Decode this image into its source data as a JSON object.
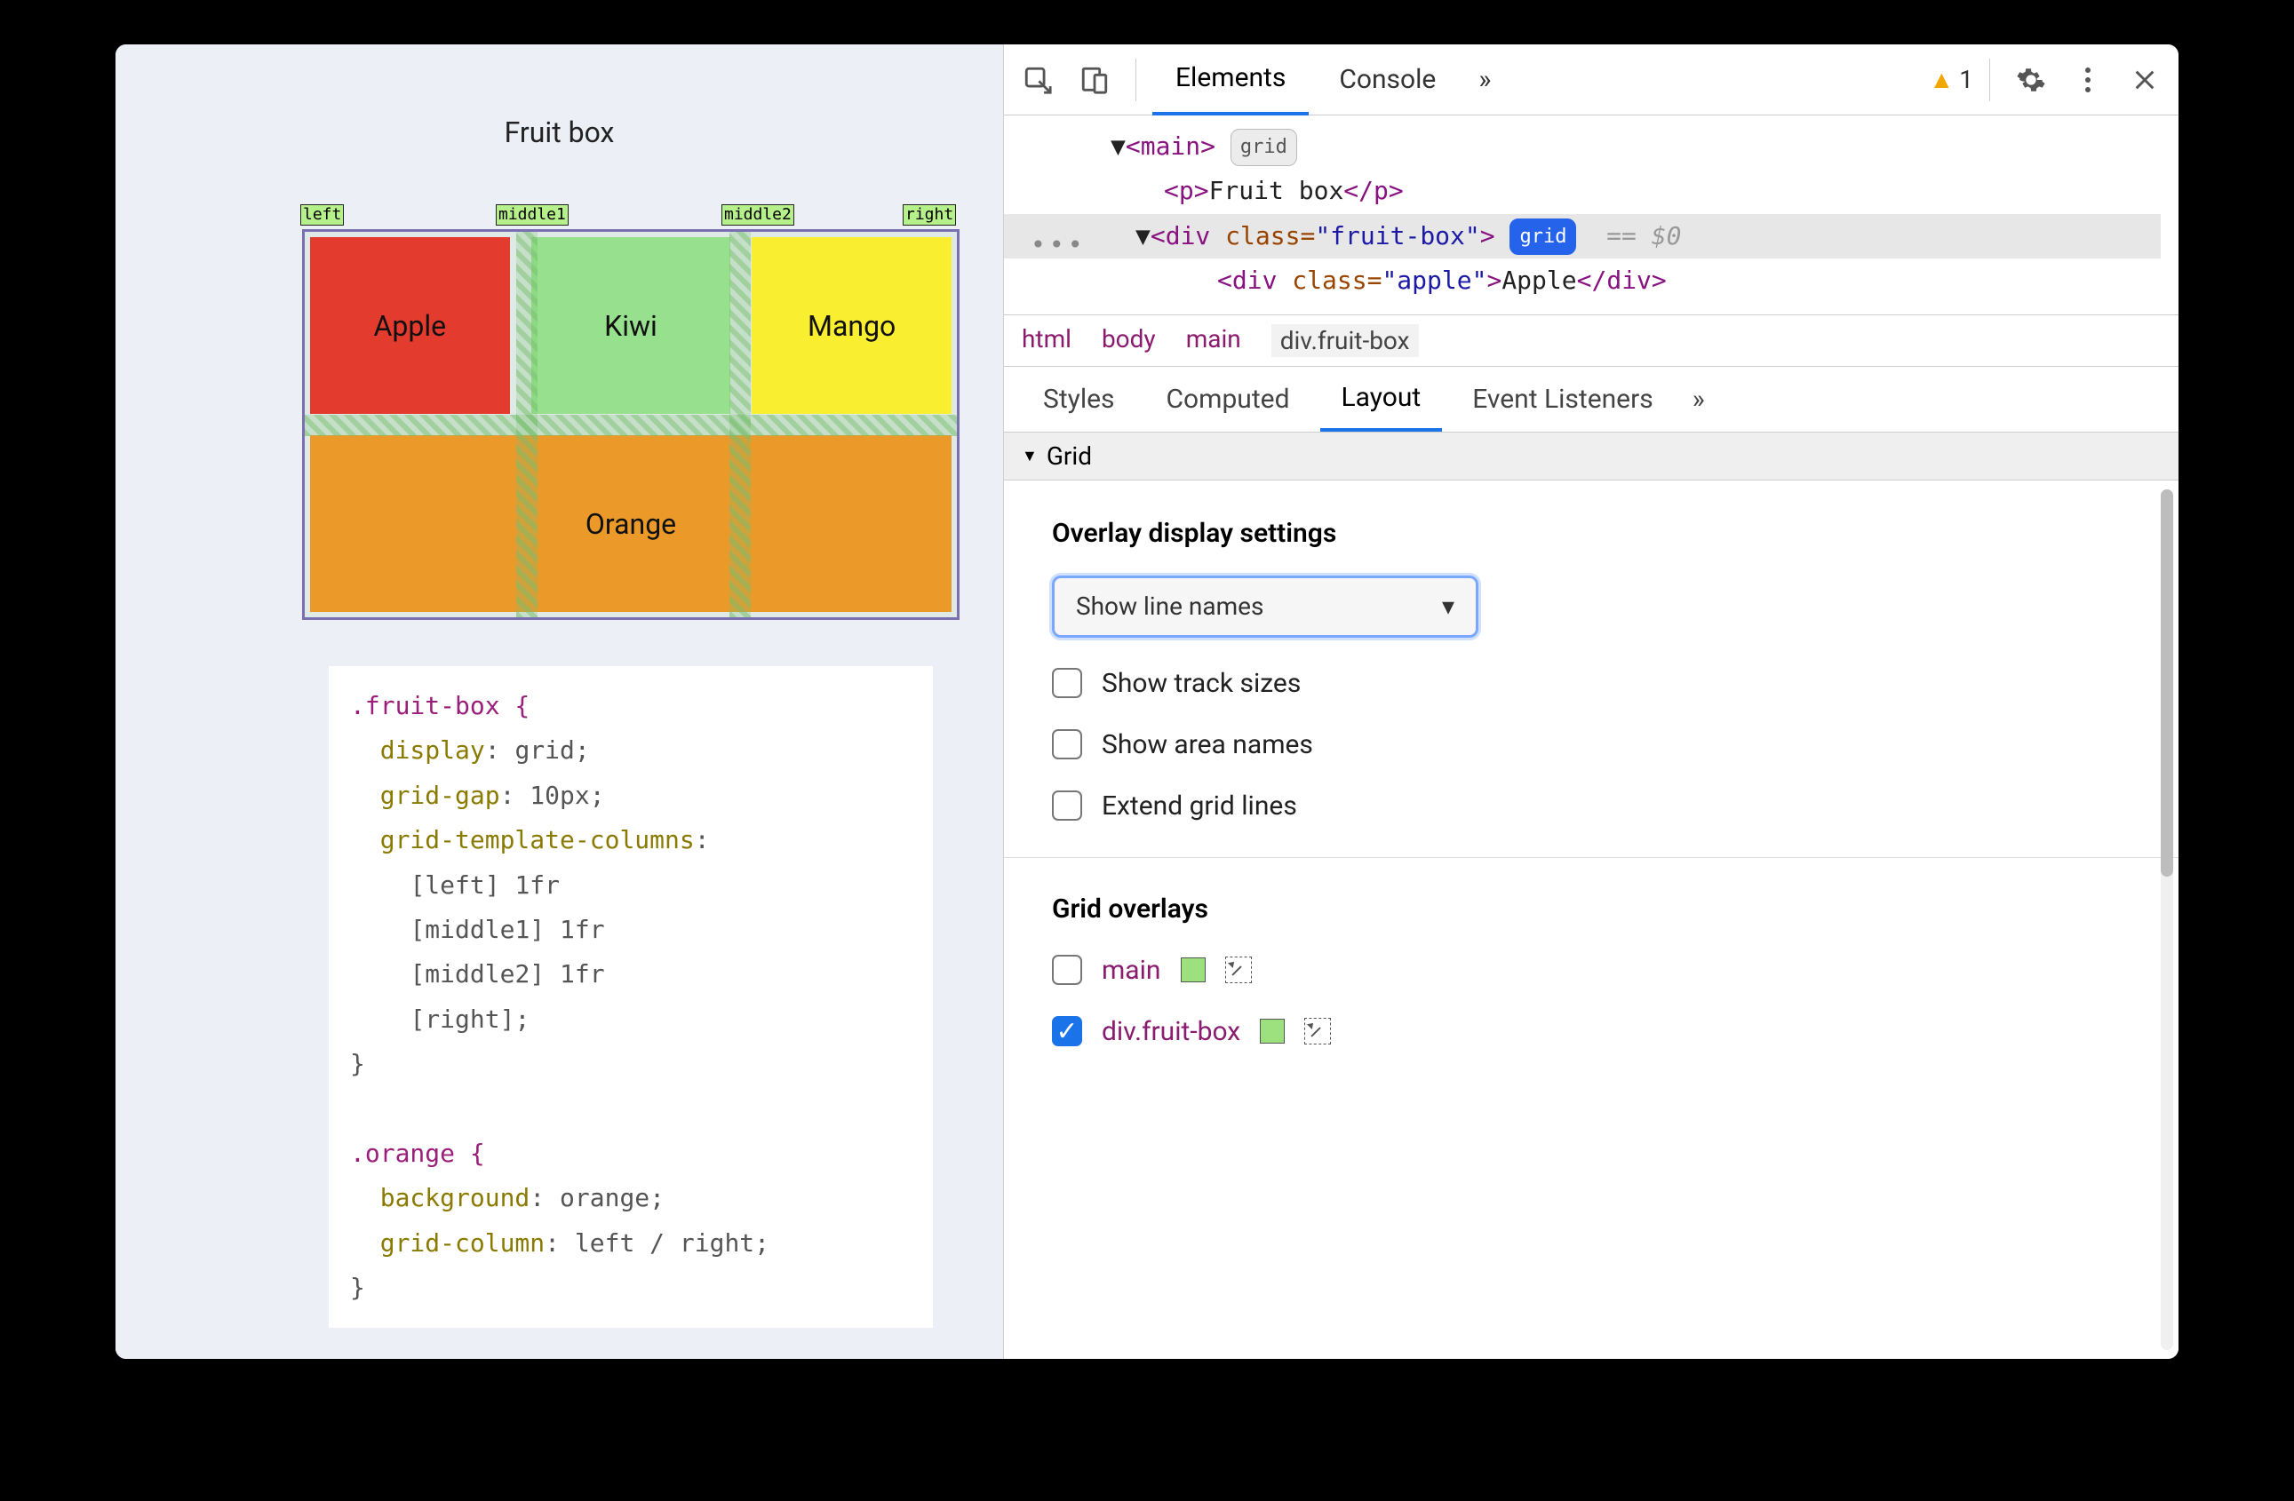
{
  "page": {
    "title": "Fruit box",
    "line_names": [
      "left",
      "middle1",
      "middle2",
      "right"
    ],
    "cells": {
      "apple": "Apple",
      "kiwi": "Kiwi",
      "mango": "Mango",
      "orange": "Orange"
    }
  },
  "css_source": {
    "sel1": ".fruit-box {",
    "p1": "display",
    "v1": "grid;",
    "p2": "grid-gap",
    "v2": "10px;",
    "p3": "grid-template-columns",
    "v3": ":",
    "l1": "[left] 1fr",
    "l2": "[middle1] 1fr",
    "l3": "[middle2] 1fr",
    "l4": "[right];",
    "close1": "}",
    "sel2": ".orange {",
    "p4": "background",
    "v4": "orange;",
    "p5": "grid-column",
    "v5": "left / right;",
    "close2": "}"
  },
  "toolbar": {
    "tabs": {
      "elements": "Elements",
      "console": "Console"
    },
    "more": "»",
    "warning_count": "1"
  },
  "dom": {
    "main_open": "<main>",
    "main_badge": "grid",
    "p_open": "<p>",
    "p_text": "Fruit box",
    "p_close": "</p>",
    "div_open_prefix": "<div ",
    "div_class_attr": "class=",
    "div_class_val": "\"fruit-box\"",
    "div_open_suffix": ">",
    "div_badge": "grid",
    "eq0": "== $0",
    "apple_open_prefix": "<div ",
    "apple_class_attr": "class=",
    "apple_class_val": "\"apple\"",
    "apple_open_suffix": ">",
    "apple_text": "Apple",
    "apple_close": "</div>",
    "dots": "•••"
  },
  "crumbs": [
    "html",
    "body",
    "main",
    "div.fruit-box"
  ],
  "styles_tabs": {
    "styles": "Styles",
    "computed": "Computed",
    "layout": "Layout",
    "listeners": "Event Listeners",
    "more": "»"
  },
  "layout": {
    "section": "Grid",
    "overlay_heading": "Overlay display settings",
    "select_value": "Show line names",
    "opts": {
      "track": "Show track sizes",
      "area": "Show area names",
      "extend": "Extend grid lines"
    },
    "overlays_heading": "Grid overlays",
    "rows": [
      {
        "checked": false,
        "label": "main"
      },
      {
        "checked": true,
        "label": "div.fruit-box"
      }
    ]
  }
}
